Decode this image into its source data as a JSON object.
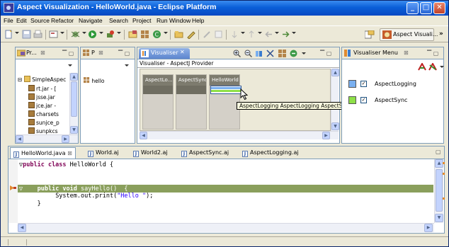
{
  "window": {
    "title": "Aspect Visualization - HelloWorld.java - Eclipse Platform",
    "min": "_",
    "max": "□",
    "close": "✕"
  },
  "menu": [
    "File",
    "Edit",
    "Source",
    "Refactor",
    "Navigate",
    "Search",
    "Project",
    "Run",
    "Window",
    "Help"
  ],
  "toolbar": {
    "perspective_label": "Aspect Visuali...",
    "overflow": "»"
  },
  "package_explorer": {
    "tab_label": "Pr...",
    "tree": [
      {
        "label": "SimpleAspec",
        "expander": "⊟"
      },
      {
        "label": "rt.jar - ["
      },
      {
        "label": "jsse.jar"
      },
      {
        "label": "jce.jar -"
      },
      {
        "label": "charsets"
      },
      {
        "label": "sunjce_p"
      },
      {
        "label": "sunpkcs"
      }
    ]
  },
  "hierarchy": {
    "tab_label": "P",
    "item": "hello"
  },
  "visualiser": {
    "tab_label": "Visualiser",
    "provider": "Visualiser - AspectJ Provider",
    "bars": [
      {
        "label": "AspectLo..."
      },
      {
        "label": "AspectSync"
      },
      {
        "label": "HelloWorld"
      }
    ],
    "tooltip": "AspectLogging AspectLogging AspectSync",
    "colors": {
      "logging": "#7ab0f0",
      "sync": "#8ee048",
      "selected_border": "#355a96"
    }
  },
  "visualiser_menu": {
    "tab_label": "Visualiser Menu",
    "items": [
      {
        "label": "AspectLogging",
        "checked": "✓",
        "color": "#7ab0f0"
      },
      {
        "label": "AspectSync",
        "checked": "✓",
        "color": "#8ee048"
      }
    ]
  },
  "editor": {
    "tabs": [
      "HelloWorld.java",
      "World.aj",
      "World2.aj",
      "AspectSync.aj",
      "AspectLogging.aj"
    ],
    "code": {
      "line1_kw": "public class",
      "line1_rest": " HelloWorld {",
      "line2_kw": "public void",
      "line2_rest": " sayHello()  {",
      "line3_prefix": "System.out.print(",
      "line3_str": "\"Hello \"",
      "line3_suffix": ");",
      "line4": "}"
    },
    "highlight_color": "#8a9f5c"
  }
}
